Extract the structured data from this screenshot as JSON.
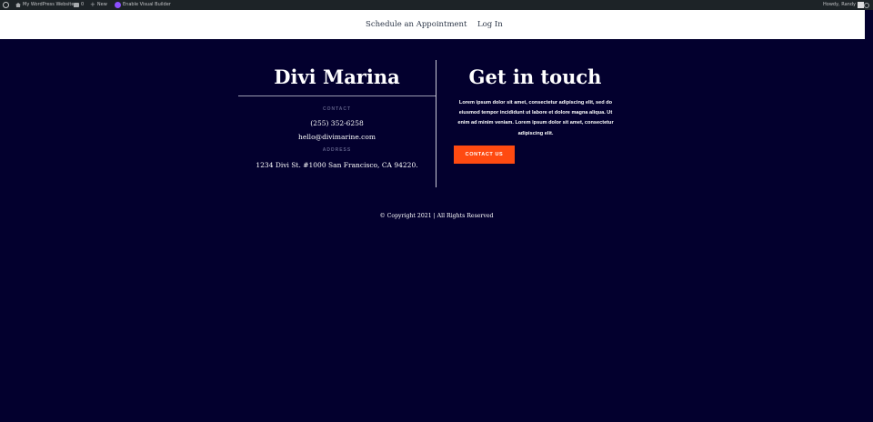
{
  "adminbar": {
    "site_name": "My WordPress Website",
    "comments_count": "0",
    "new_label": "New",
    "visual_builder_label": "Enable Visual Builder",
    "howdy": "Howdy, Randy"
  },
  "nav": {
    "appointment": "Schedule an Appointment",
    "login": "Log In"
  },
  "footer": {
    "brand": "Divi Marina",
    "contact_label": "CONTACT",
    "phone": "(255) 352-6258",
    "email": "hello@divimarine.com",
    "address_label": "ADDRESS",
    "address": "1234 Divi St. #1000 San Francisco, CA 94220.",
    "touch_title": "Get in touch",
    "touch_text": "Lorem ipsum dolor sit amet, consectetur adipiscing elit, sed do eiusmod tempor incididunt ut labore et dolore magna aliqua. Ut enim ad minim veniam. Lorem ipsum dolor sit amet, consectetur adipiscing elit.",
    "contact_button": "CONTACT US",
    "copyright": "© Copyright 2021 | All Rights Reserved"
  },
  "colors": {
    "background": "#03002e",
    "accent": "#ff4a11",
    "adminbar": "#1d2327"
  }
}
